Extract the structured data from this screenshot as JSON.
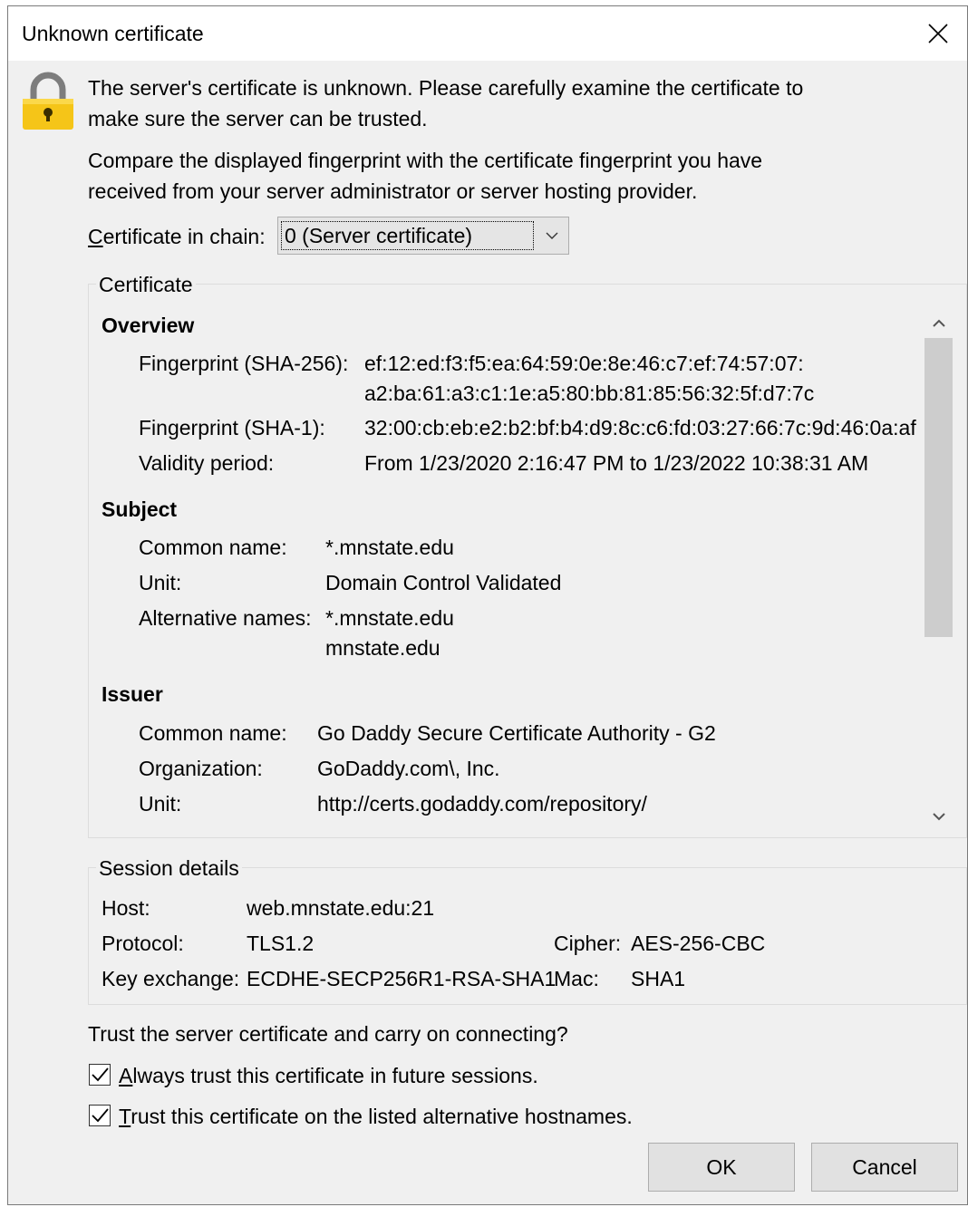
{
  "window": {
    "title": "Unknown certificate"
  },
  "intro": {
    "line1": "The server's certificate is unknown. Please carefully examine the certificate to",
    "line2": "make sure the server can be trusted.",
    "line3": "Compare the displayed fingerprint with the certificate fingerprint you have",
    "line4": "received from your server administrator or server hosting provider."
  },
  "chain": {
    "label_key": "C",
    "label_rest": "ertificate in chain:",
    "selected": "0 (Server certificate)"
  },
  "certificate": {
    "legend": "Certificate",
    "overview": {
      "heading": "Overview",
      "sha256_label": "Fingerprint (SHA-256):",
      "sha256_line1": "ef:12:ed:f3:f5:ea:64:59:0e:8e:46:c7:ef:74:57:07:",
      "sha256_line2": "a2:ba:61:a3:c1:1e:a5:80:bb:81:85:56:32:5f:d7:7c",
      "sha1_label": "Fingerprint (SHA-1):",
      "sha1_value": "32:00:cb:eb:e2:b2:bf:b4:d9:8c:c6:fd:03:27:66:7c:9d:46:0a:af",
      "validity_label": "Validity period:",
      "validity_value": "From 1/23/2020 2:16:47 PM to 1/23/2022 10:38:31 AM"
    },
    "subject": {
      "heading": "Subject",
      "cn_label": "Common name:",
      "cn_value": "*.mnstate.edu",
      "unit_label": "Unit:",
      "unit_value": "Domain Control Validated",
      "alt_label": "Alternative names:",
      "alt_value1": "*.mnstate.edu",
      "alt_value2": "mnstate.edu"
    },
    "issuer": {
      "heading": "Issuer",
      "cn_label": "Common name:",
      "cn_value": "Go Daddy Secure Certificate Authority - G2",
      "org_label": "Organization:",
      "org_value": "GoDaddy.com\\, Inc.",
      "unit_label": "Unit:",
      "unit_value": "http://certs.godaddy.com/repository/"
    }
  },
  "session": {
    "legend": "Session details",
    "host_label": "Host:",
    "host_value": "web.mnstate.edu:21",
    "protocol_label": "Protocol:",
    "protocol_value": "TLS1.2",
    "cipher_label": "Cipher:",
    "cipher_value": "AES-256-CBC",
    "kex_label": "Key exchange:",
    "kex_value": "ECDHE-SECP256R1-RSA-SHA1",
    "mac_label": "Mac:",
    "mac_value": "SHA1"
  },
  "trust": {
    "question": "Trust the server certificate and carry on connecting?",
    "always_key": "A",
    "always_rest": "lways trust this certificate in future sessions.",
    "always_checked": true,
    "alt_key": "T",
    "alt_rest": "rust this certificate on the listed alternative hostnames.",
    "alt_checked": true
  },
  "buttons": {
    "ok": "OK",
    "cancel": "Cancel"
  },
  "colors": {
    "lock_body": "#f5c518",
    "lock_shackle": "#7d7d7d",
    "window_bg": "#f0f0f0"
  },
  "icons": {
    "lock": "padlock-icon",
    "close": "close-icon",
    "dropdown": "chevron-down-icon"
  }
}
